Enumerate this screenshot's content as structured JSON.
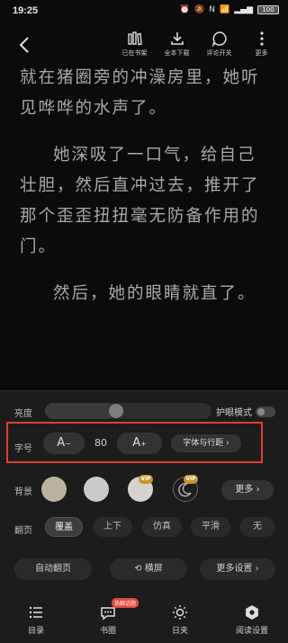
{
  "status_bar": {
    "time": "19:25",
    "battery": "100"
  },
  "top_bar": {
    "actions": [
      {
        "label": "已在书架",
        "icon": "bookshelf-icon"
      },
      {
        "label": "全本下载",
        "icon": "download-icon"
      },
      {
        "label": "评论开关",
        "icon": "comment-icon"
      },
      {
        "label": "更多",
        "icon": "more-icon"
      }
    ]
  },
  "reader": {
    "paragraphs": [
      "就在猪圈旁的冲澡房里，她听见哗哗的水声了。",
      "她深吸了一口气，给自己壮胆，然后直冲过去，推开了那个歪歪扭扭毫无防备作用的门。",
      "然后，她的眼睛就直了。"
    ]
  },
  "settings": {
    "brightness_label": "亮度",
    "brightness_level": 0.42,
    "eye_mode_label": "护眼模式",
    "font_size_label": "字号",
    "font_decrease": "A",
    "font_size_value": "80",
    "font_increase": "A",
    "font_settings": "字体与行距 ›",
    "background_label": "背景",
    "background_swatches": [
      "#b9b39f",
      "#c9cbcb",
      "#d6d2cc",
      "#1e1e1e"
    ],
    "vip": "VIP",
    "more_label": "更多 ›",
    "flip_label": "翻页",
    "flip_options": [
      "覆盖",
      "上下",
      "仿真",
      "平滑",
      "无"
    ],
    "flip_selected": 0,
    "auto_flip": "自动翻页",
    "landscape": "横屏",
    "more_settings": "更多设置 ›"
  },
  "nav": {
    "items": [
      {
        "label": "目录",
        "icon": "catalog-icon"
      },
      {
        "label": "书圈",
        "icon": "community-icon",
        "badge": "热聊话题"
      },
      {
        "label": "日夹",
        "icon": "day-mode-icon"
      },
      {
        "label": "阅读设置",
        "icon": "settings-gear-icon"
      }
    ]
  },
  "colors": {
    "accent_red": "#e53b33",
    "vip_gold": "#c8962b"
  }
}
